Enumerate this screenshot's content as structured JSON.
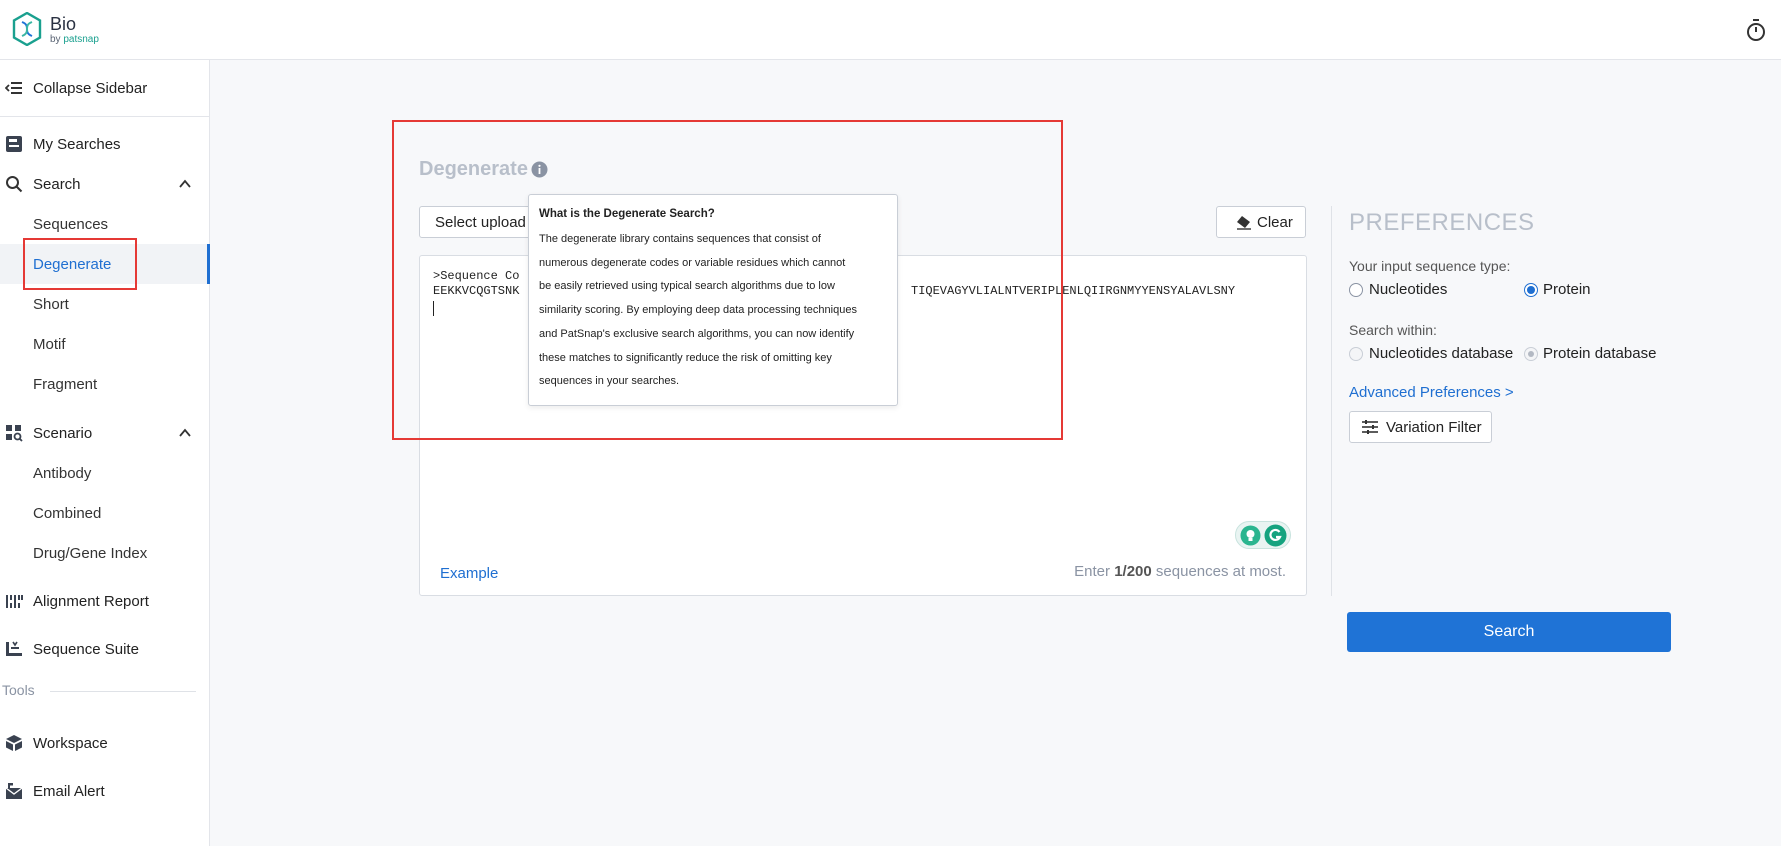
{
  "brand": {
    "name": "Bio",
    "sub_prefix": "by",
    "sub_brand": "patsnap"
  },
  "sidebar": {
    "collapse_label": "Collapse Sidebar",
    "my_searches": "My Searches",
    "search": "Search",
    "search_items": [
      "Sequences",
      "Degenerate",
      "Short",
      "Motif",
      "Fragment"
    ],
    "scenario": "Scenario",
    "scenario_items": [
      "Antibody",
      "Combined",
      "Drug/Gene Index"
    ],
    "alignment_report": "Alignment Report",
    "sequence_suite": "Sequence Suite",
    "tools_label": "Tools",
    "workspace": "Workspace",
    "email_alert": "Email Alert",
    "active_item": "Degenerate"
  },
  "main": {
    "title": "Degenerate",
    "upload_select": "Select upload m",
    "clear_label": "Clear",
    "sequence_lines": [
      ">Sequence Co",
      "EEKKVCQGTSNK"
    ],
    "sequence_tail": "TIQEVAGYVLIALNTVERIPLENLQIIRGNMYYENSYALAVLSNY",
    "example_label": "Example",
    "counter_prefix": "Enter ",
    "counter_value": "1/200",
    "counter_suffix": " sequences at most."
  },
  "tooltip": {
    "title": "What is the Degenerate Search?",
    "body_lines": [
      "The degenerate library contains sequences that consist of",
      "numerous degenerate codes or variable residues which cannot",
      "be easily retrieved using typical search algorithms due to low",
      "similarity scoring. By employing deep data processing techniques",
      "and PatSnap's exclusive search algorithms, you can now identify",
      "these matches to significantly reduce the risk of omitting key",
      "sequences in your searches."
    ]
  },
  "preferences": {
    "title": "PREFERENCES",
    "input_type_label": "Your input sequence type:",
    "input_options": [
      "Nucleotides",
      "Protein"
    ],
    "input_selected": "Protein",
    "search_within_label": "Search within:",
    "within_options": [
      "Nucleotides database",
      "Protein database"
    ],
    "within_selected": "Protein database",
    "advanced_link": "Advanced Preferences >",
    "variation_filter": "Variation Filter",
    "search_button": "Search"
  },
  "colors": {
    "accent": "#1f73d6",
    "annotation": "#e53935",
    "brand_teal": "#1aa08f"
  }
}
